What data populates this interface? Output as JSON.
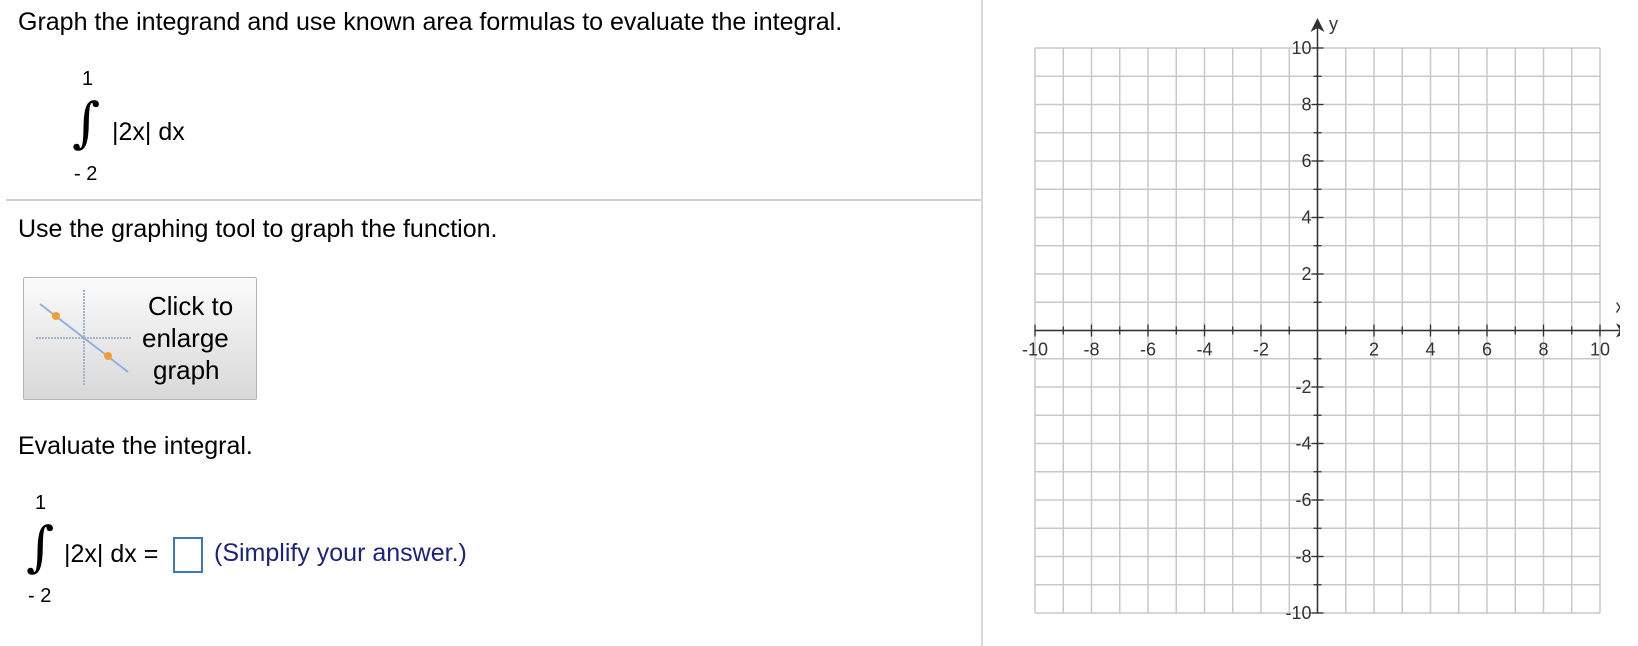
{
  "question": {
    "title": "Graph the integrand and use known area formulas to evaluate the integral.",
    "integral": {
      "upper": "1",
      "lower": "- 2",
      "integrand": "|2x| dx"
    }
  },
  "instruction": "Use the graphing tool to graph the function.",
  "enlarge_button": {
    "line1": "Click to",
    "line2": "enlarge",
    "line3": "graph"
  },
  "evaluate": {
    "label": "Evaluate the integral.",
    "upper": "1",
    "lower": "- 2",
    "integrand": "|2x| dx =",
    "answer_value": "",
    "hint": "(Simplify your answer.)"
  },
  "graph": {
    "x_axis_label": "x",
    "y_axis_label": "y",
    "x_range": [
      -10,
      10
    ],
    "y_range": [
      -10,
      10
    ],
    "grid": true,
    "x_ticks": [
      "-10",
      "-8",
      "-6",
      "-4",
      "-2",
      "2",
      "4",
      "6",
      "8",
      "10"
    ],
    "y_ticks": [
      "10",
      "8",
      "6",
      "4",
      "2",
      "-2",
      "-4",
      "-6",
      "-8",
      "-10"
    ],
    "colors": {
      "grid": "#c8c8c8",
      "axis": "#333333",
      "accent": "#3a78c0",
      "hint_text": "#1a237e"
    }
  }
}
